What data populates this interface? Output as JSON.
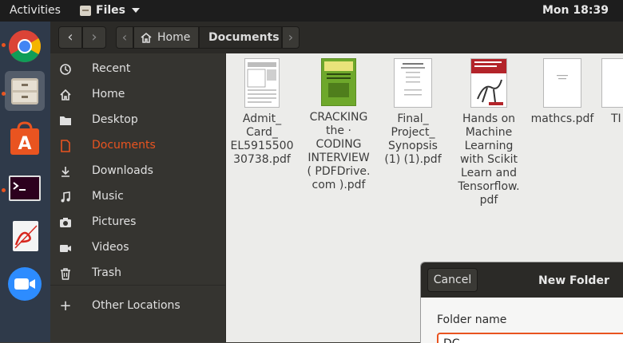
{
  "topbar": {
    "activities": "Activities",
    "app_name": "Files",
    "clock": "Mon 18:39"
  },
  "dock": {
    "items": [
      {
        "name": "Google Chrome",
        "icon": "chrome-icon"
      },
      {
        "name": "Files",
        "icon": "files-icon"
      },
      {
        "name": "Ubuntu Software",
        "icon": "software-icon"
      },
      {
        "name": "Terminal",
        "icon": "terminal-icon"
      },
      {
        "name": "Document Viewer",
        "icon": "pdf-viewer-icon"
      },
      {
        "name": "Zoom",
        "icon": "zoom-icon"
      }
    ]
  },
  "header": {
    "back": "‹",
    "forward": "›",
    "left_scroll": "‹",
    "right_scroll": "›",
    "crumbs": [
      "Home",
      "Documents"
    ]
  },
  "sidebar": {
    "items": [
      {
        "label": "Recent",
        "icon": "clock-icon"
      },
      {
        "label": "Home",
        "icon": "home-icon"
      },
      {
        "label": "Desktop",
        "icon": "folder-icon"
      },
      {
        "label": "Documents",
        "icon": "document-icon"
      },
      {
        "label": "Downloads",
        "icon": "download-icon"
      },
      {
        "label": "Music",
        "icon": "music-icon"
      },
      {
        "label": "Pictures",
        "icon": "camera-icon"
      },
      {
        "label": "Videos",
        "icon": "video-icon"
      },
      {
        "label": "Trash",
        "icon": "trash-icon"
      },
      {
        "label": "Other Locations",
        "icon": "plus-icon"
      }
    ]
  },
  "files": [
    {
      "name": "Admit_\nCard_\nEL5915500\n30738.pdf"
    },
    {
      "name": "CRACKING\nthe ·\nCODING\nINTERVIEW\n( PDFDrive.\ncom ).pdf"
    },
    {
      "name": "Final_\nProject_\nSynopsis\n(1) (1).pdf"
    },
    {
      "name": "Hands on\nMachine\nLearning\nwith Scikit\nLearn and\nTensorflow.\npdf"
    },
    {
      "name": "mathcs.pdf"
    },
    {
      "name": "TI"
    }
  ],
  "dialog": {
    "cancel": "Cancel",
    "title": "New Folder",
    "field_label": "Folder name",
    "field_value": "DC"
  },
  "colors": {
    "accent": "#e95420",
    "sidebar_bg": "#353430",
    "content_bg": "#ececea",
    "dock_bg": "#2f3a4a"
  }
}
